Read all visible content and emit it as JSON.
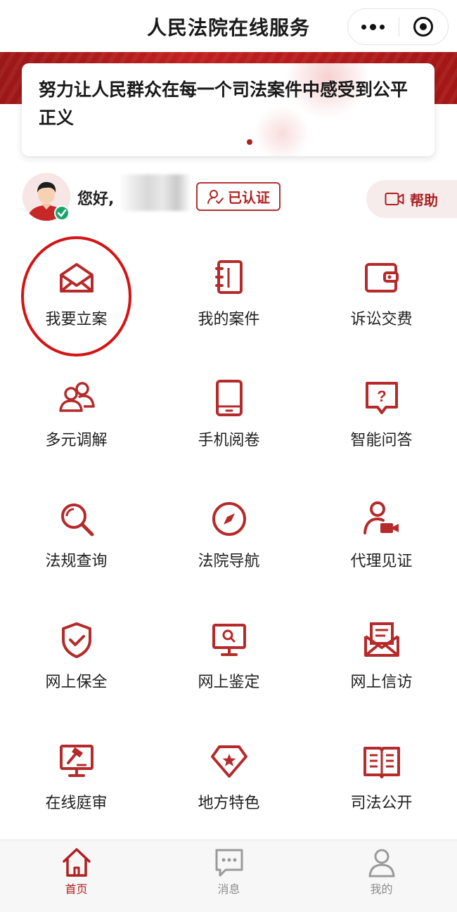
{
  "header": {
    "title": "人民法院在线服务"
  },
  "banner": {
    "slogan": "努力让人民群众在每一个司法案件中感受到公平正义"
  },
  "user": {
    "greeting": "您好,",
    "verified_label": "已认证",
    "help_label": "帮助"
  },
  "grid": {
    "items": [
      {
        "label": "我要立案",
        "icon": "envelope-open-icon"
      },
      {
        "label": "我的案件",
        "icon": "notebook-icon"
      },
      {
        "label": "诉讼交费",
        "icon": "wallet-icon"
      },
      {
        "label": "多元调解",
        "icon": "people-icon"
      },
      {
        "label": "手机阅卷",
        "icon": "tablet-icon"
      },
      {
        "label": "智能问答",
        "icon": "question-bubble-icon"
      },
      {
        "label": "法规查询",
        "icon": "magnifier-icon"
      },
      {
        "label": "法院导航",
        "icon": "compass-icon"
      },
      {
        "label": "代理见证",
        "icon": "person-video-icon"
      },
      {
        "label": "网上保全",
        "icon": "shield-check-icon"
      },
      {
        "label": "网上鉴定",
        "icon": "monitor-search-icon"
      },
      {
        "label": "网上信访",
        "icon": "letter-icon"
      },
      {
        "label": "在线庭审",
        "icon": "monitor-gavel-icon"
      },
      {
        "label": "地方特色",
        "icon": "gem-star-icon"
      },
      {
        "label": "司法公开",
        "icon": "open-book-icon"
      }
    ]
  },
  "tabbar": {
    "tabs": [
      {
        "label": "首页",
        "icon": "home-icon",
        "active": true
      },
      {
        "label": "消息",
        "icon": "message-icon",
        "active": false
      },
      {
        "label": "我的",
        "icon": "user-icon",
        "active": false
      }
    ]
  },
  "colors": {
    "accent": "#b01e1e",
    "banner": "#b51c1c",
    "highlight": "#d41414"
  }
}
